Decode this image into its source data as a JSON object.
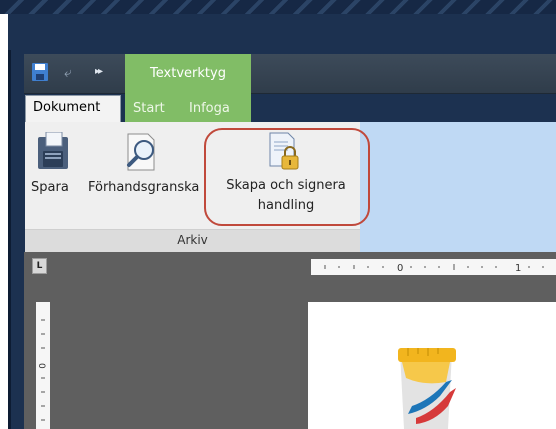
{
  "qat": {
    "save_icon": "save-icon",
    "undo_icon": "undo-icon",
    "more_icon": "more-commands-icon"
  },
  "context_group": {
    "label": "Textverktyg"
  },
  "tabs": [
    {
      "label": "Dokument",
      "active": true
    },
    {
      "label": "Start",
      "active": false
    },
    {
      "label": "Infoga",
      "active": false
    }
  ],
  "ribbon": {
    "buttons": [
      {
        "label": "Spara",
        "icon": "floppy-disk-icon"
      },
      {
        "label": "Förhandsgranska",
        "icon": "magnifier-icon"
      },
      {
        "label_line1": "Skapa och signera",
        "label_line2": "handling",
        "icon": "lock-document-icon"
      }
    ],
    "group_label": "Arkiv"
  },
  "ruler": {
    "corner_label": "L",
    "h_numbers": [
      "0",
      "1"
    ],
    "v_numbers": [
      "0"
    ]
  },
  "colors": {
    "context_green": "#81bd66",
    "highlight_red": "#c0493b",
    "selection_blue": "#bfd9f4",
    "title_navy": "#1c3150"
  }
}
